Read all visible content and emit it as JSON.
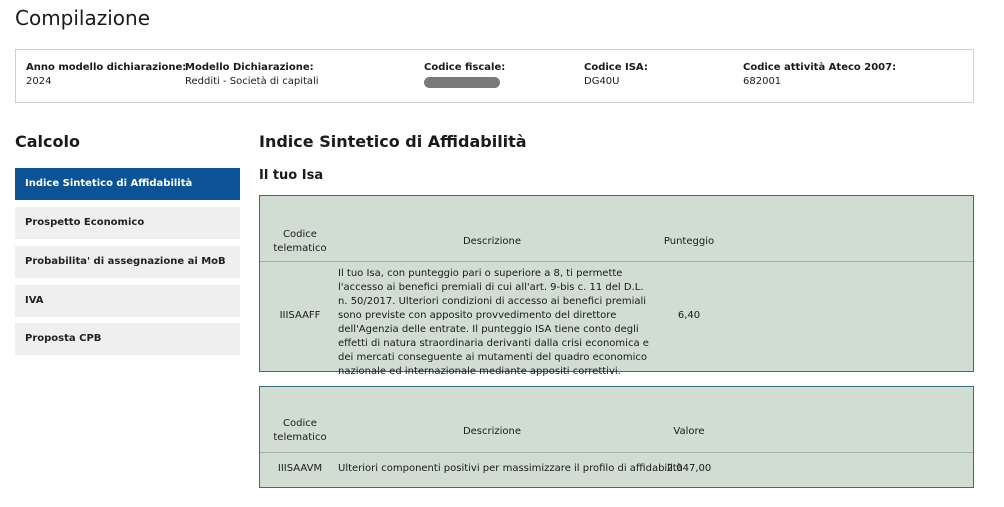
{
  "header": {
    "title": "Compilazione"
  },
  "info": {
    "anno_label": "Anno modello dichiarazione:",
    "anno_value": "2024",
    "modello_label": "Modello Dichiarazione:",
    "modello_value": "Redditi - Società di capitali",
    "cf_label": "Codice fiscale:",
    "isa_label": "Codice ISA:",
    "isa_value": "DG40U",
    "ateco_label": "Codice attività Ateco 2007:",
    "ateco_value": "682001"
  },
  "sidebar": {
    "title": "Calcolo",
    "items": [
      {
        "label": "Indice Sintetico di Affidabilità"
      },
      {
        "label": "Prospetto Economico"
      },
      {
        "label": "Probabilita' di assegnazione ai MoB"
      },
      {
        "label": "IVA"
      },
      {
        "label": "Proposta CPB"
      }
    ],
    "active_index": 0
  },
  "main": {
    "title": "Indice Sintetico di Affidabilità",
    "subtitle": "Il tuo Isa",
    "table1": {
      "col_code": "Codice telematico",
      "col_desc": "Descrizione",
      "col_score": "Punteggio",
      "row": {
        "code": "IIISAAFF",
        "desc": "Il tuo Isa, con punteggio pari o superiore a 8, ti permette l'accesso ai benefici premiali di cui all'art. 9-bis c. 11 del D.L. n. 50/2017. Ulteriori condizioni di accesso ai benefici premiali sono previste con apposito provvedimento del direttore dell'Agenzia delle entrate. Il punteggio ISA tiene conto degli effetti di natura straordinaria derivanti dalla crisi economica e dei mercati conseguente ai mutamenti del quadro economico nazionale ed internazionale mediante appositi correttivi.",
        "score": "6,40"
      }
    },
    "table2": {
      "col_code": "Codice telematico",
      "col_desc": "Descrizione",
      "col_value": "Valore",
      "row": {
        "code": "IIISAAVM",
        "desc": "Ulteriori componenti positivi per massimizzare il profilo di affidabilità",
        "value": "2.047,00"
      }
    }
  },
  "colors": {
    "active_nav": "#0b5394",
    "table_bg": "#d1dcd3",
    "table_border": "#33707e"
  }
}
